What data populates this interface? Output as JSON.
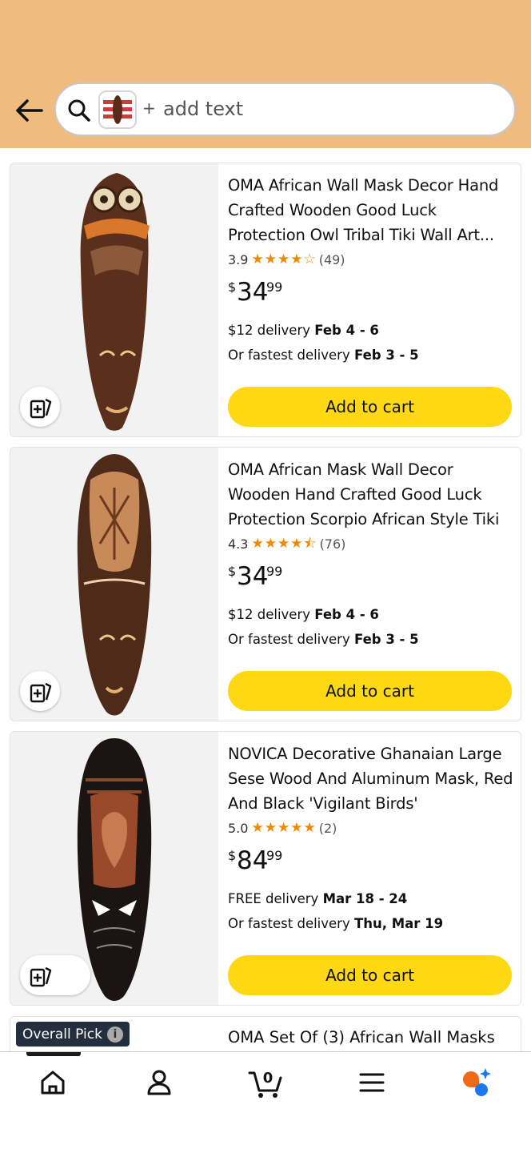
{
  "search": {
    "placeholder_prefix": "+",
    "placeholder": "add text"
  },
  "products": [
    {
      "title": "OMA African Wall Mask Decor Hand Crafted Wooden Good Luck Protection Owl Tribal Tiki Wall Art...",
      "rating": "3.9",
      "stars": 3.9,
      "reviews": "(49)",
      "price_symbol": "$",
      "price_whole": "34",
      "price_cents": "99",
      "delivery_prefix": "$12 delivery ",
      "delivery_date": "Feb 4 - 6",
      "fastest_prefix": "Or fastest delivery ",
      "fastest_date": "Feb 3 - 5",
      "cart_label": "Add to cart"
    },
    {
      "title": "OMA African Mask Wall Decor Wooden Hand Crafted Good Luck Protection Scorpio African Style Tiki Mask Hom...",
      "rating": "4.3",
      "stars": 4.3,
      "reviews": "(76)",
      "price_symbol": "$",
      "price_whole": "34",
      "price_cents": "99",
      "delivery_prefix": "$12 delivery ",
      "delivery_date": "Feb 4 - 6",
      "fastest_prefix": "Or fastest delivery ",
      "fastest_date": "Feb 3 - 5",
      "cart_label": "Add to cart"
    },
    {
      "title": "NOVICA Decorative Ghanaian Large Sese Wood And Aluminum Mask, Red And Black 'Vigilant Birds'",
      "rating": "5.0",
      "stars": 5.0,
      "reviews": "(2)",
      "price_symbol": "$",
      "price_whole": "84",
      "price_cents": "99",
      "delivery_prefix": "FREE delivery ",
      "delivery_date": "Mar 18 - 24",
      "fastest_prefix": "Or fastest delivery ",
      "fastest_date": "Thu, Mar 19",
      "cart_label": "Add to cart"
    }
  ],
  "partial": {
    "badge": "Overall Pick",
    "badge_icon": "i",
    "title": "OMA Set Of (3) African Wall Masks"
  },
  "nav": {
    "cart_count": "0",
    "items": [
      "home-icon",
      "account-icon",
      "cart-icon",
      "menu-icon",
      "rufus-icon"
    ]
  },
  "colors": {
    "header": "#efbb7f",
    "cart_button": "#ffd814",
    "star": "#f08804",
    "badge": "#232f3e"
  }
}
